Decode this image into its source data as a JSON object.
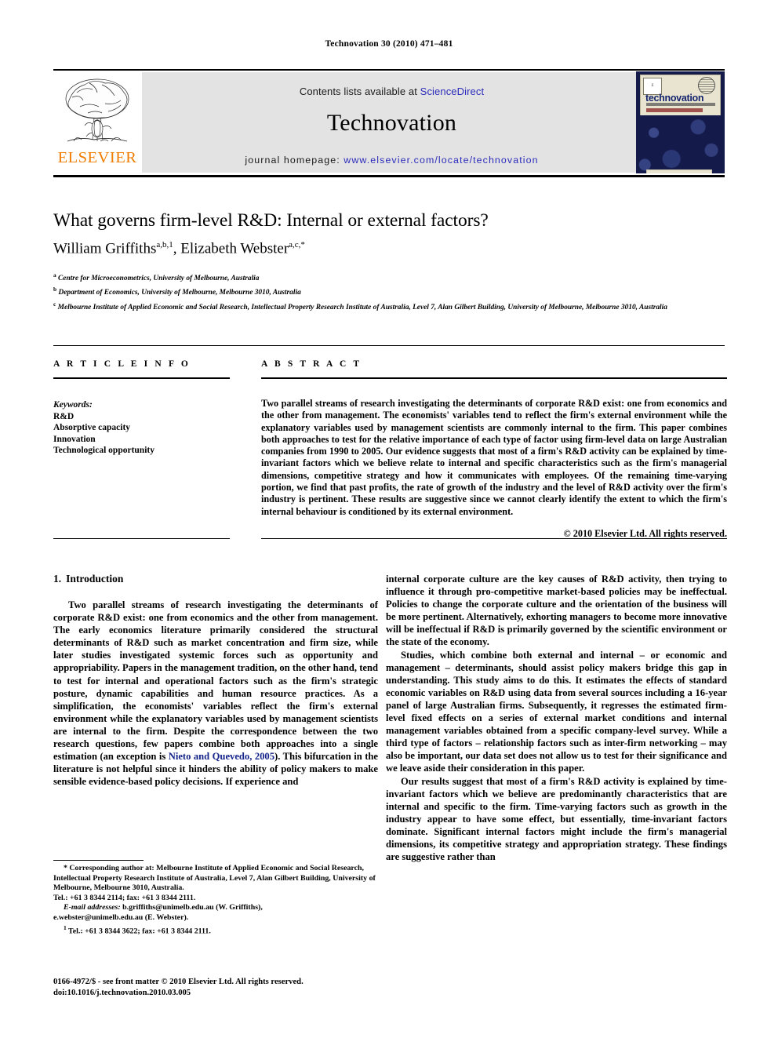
{
  "running_head": "Technovation 30 (2010) 471–481",
  "banner": {
    "publisher": "ELSEVIER",
    "contents_prefix": "Contents lists available at",
    "contents_link": "ScienceDirect",
    "journal_title": "Technovation",
    "homepage_prefix": "journal homepage:",
    "homepage_link": "www.elsevier.com/locate/technovation",
    "cover_title": "technovation",
    "cover_publisher": "ELSEVIER",
    "link_color": "#2b2bbb",
    "elsevier_orange": "#f07c00",
    "cover_background": "#141a4a"
  },
  "article": {
    "title": "What governs firm-level R&D: Internal or external factors?",
    "authors": [
      {
        "name": "William Griffiths",
        "marks": "a,b,1",
        "separator": ", "
      },
      {
        "name": "Elizabeth Webster",
        "marks": "a,c,*",
        "separator": ""
      }
    ],
    "affiliations": [
      {
        "mark": "a",
        "text": "Centre for Microeconometrics, University of Melbourne, Australia"
      },
      {
        "mark": "b",
        "text": "Department of Economics, University of Melbourne, Melbourne 3010, Australia"
      },
      {
        "mark": "c",
        "text": "Melbourne Institute of Applied Economic and Social Research, Intellectual Property Research Institute of Australia, Level 7, Alan Gilbert Building, University of Melbourne, Melbourne 3010, Australia"
      }
    ]
  },
  "info": {
    "heading": "A R T I C L E   I N F O",
    "keywords_label": "Keywords:",
    "keywords": [
      "R&D",
      "Absorptive capacity",
      "Innovation",
      "Technological opportunity"
    ]
  },
  "abstract": {
    "heading": "A B S T R A C T",
    "text": "Two parallel streams of research investigating the determinants of corporate R&D exist: one from economics and the other from management. The economists' variables tend to reflect the firm's external environment while the explanatory variables used by management scientists are commonly internal to the firm. This paper combines both approaches to test for the relative importance of each type of factor using firm-level data on large Australian companies from 1990 to 2005. Our evidence suggests that most of a firm's R&D activity can be explained by time-invariant factors which we believe relate to internal and specific characteristics such as the firm's managerial dimensions, competitive strategy and how it communicates with employees. Of the remaining time-varying portion, we find that past profits, the rate of growth of the industry and the level of R&D activity over the firm's industry is pertinent. These results are suggestive since we cannot clearly identify the extent to which the firm's internal behaviour is conditioned by its external environment.",
    "rights": "© 2010 Elsevier Ltd. All rights reserved."
  },
  "body": {
    "section_number": "1.",
    "section_title": "Introduction",
    "left_paragraph_1_a": "Two parallel streams of research investigating the determinants of corporate R&D exist: one from economics and the other from management. The early economics literature primarily considered the structural determinants of R&D such as market concentration and firm size, while later studies investigated systemic forces such as opportunity and appropriability. Papers in the management tradition, on the other hand, tend to test for internal and operational factors such as the firm's strategic posture, dynamic capabilities and human resource practices. As a simplification, the economists' variables reflect the firm's external environment while the explanatory variables used by management scientists are internal to the firm. Despite the correspondence between the two research questions, few papers combine both approaches into a single estimation (an exception is ",
    "left_citation": "Nieto and Quevedo, 2005",
    "left_paragraph_1_b": "). This bifurcation in the literature is not helpful since it hinders the ability of policy makers to make sensible evidence-based policy decisions. If experience and",
    "right_paragraph_1_cont": "internal corporate culture are the key causes of R&D activity, then trying to influence it through pro-competitive market-based policies may be ineffectual. Policies to change the corporate culture and the orientation of the business will be more pertinent. Alternatively, exhorting managers to become more innovative will be ineffectual if R&D is primarily governed by the scientific environment or the state of the economy.",
    "right_paragraph_2": "Studies, which combine both external and internal – or economic and management – determinants, should assist policy makers bridge this gap in understanding. This study aims to do this. It estimates the effects of standard economic variables on R&D using data from several sources including a 16-year panel of large Australian firms. Subsequently, it regresses the estimated firm-level fixed effects on a series of external market conditions and internal management variables obtained from a specific company-level survey. While a third type of factors – relationship factors such as inter-firm networking – may also be important, our data set does not allow us to test for their significance and we leave aside their consideration in this paper.",
    "right_paragraph_3": "Our results suggest that most of a firm's R&D activity is explained by time-invariant factors which we believe are predominantly characteristics that are internal and specific to the firm. Time-varying factors such as growth in the industry appear to have some effect, but essentially, time-invariant factors dominate. Significant internal factors might include the firm's managerial dimensions, its competitive strategy and appropriation strategy. These findings are suggestive rather than"
  },
  "footnotes": {
    "corresponding": "* Corresponding author at: Melbourne Institute of Applied Economic and Social Research, Intellectual Property Research Institute of Australia, Level 7, Alan Gilbert Building, University of Melbourne, Melbourne 3010, Australia.",
    "corresponding_tel": "Tel.: +61 3 8344 2114; fax: +61 3 8344 2111.",
    "email_label": "E-mail addresses:",
    "email_1": "b.griffiths@unimelb.edu.au (W. Griffiths),",
    "email_2": "e.webster@unimelb.edu.au (E. Webster).",
    "note_1_mark": "1",
    "note_1": "Tel.: +61 3 8344 3622; fax: +61 3 8344 2111."
  },
  "imprint": {
    "line_1": "0166-4972/$ - see front matter © 2010 Elsevier Ltd. All rights reserved.",
    "line_2": "doi:10.1016/j.technovation.2010.03.005"
  }
}
